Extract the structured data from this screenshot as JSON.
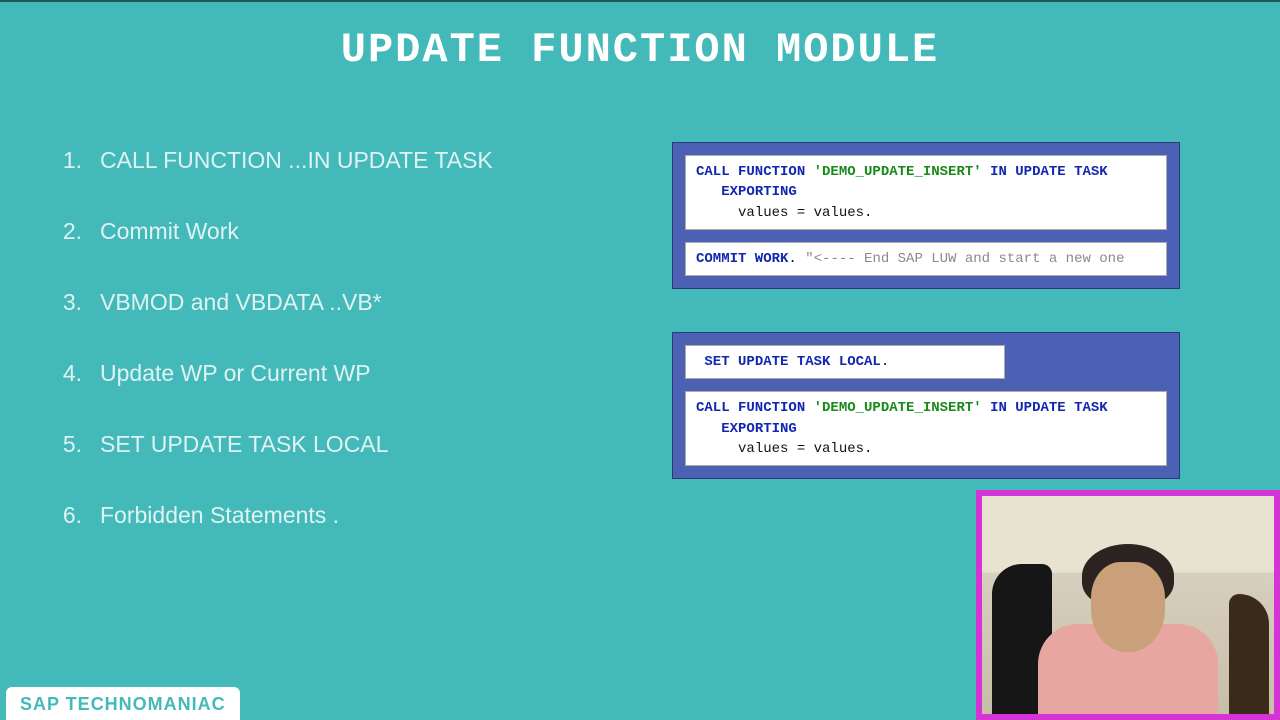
{
  "title": "UPDATE FUNCTION MODULE",
  "list": {
    "items": [
      {
        "num": "1.",
        "text": "CALL FUNCTION ...IN UPDATE TASK"
      },
      {
        "num": "2.",
        "text": "Commit Work"
      },
      {
        "num": "3.",
        "text": "VBMOD and VBDATA ..VB*"
      },
      {
        "num": "4.",
        "text": "Update WP or Current WP"
      },
      {
        "num": "5.",
        "text": "SET UPDATE TASK LOCAL"
      },
      {
        "num": "6.",
        "text": "Forbidden Statements ."
      }
    ]
  },
  "code": {
    "call_function": "CALL FUNCTION",
    "fm_name": "'DEMO_UPDATE_INSERT'",
    "in_update_task": "IN UPDATE TASK",
    "exporting": "EXPORTING",
    "values_line": "values = values",
    "commit_work": "COMMIT WORK",
    "commit_comment": "\"<---- End SAP LUW and start a new one",
    "set_update": "SET UPDATE TASK LOCAL"
  },
  "badge": "SAP TECHNOMANIAC"
}
